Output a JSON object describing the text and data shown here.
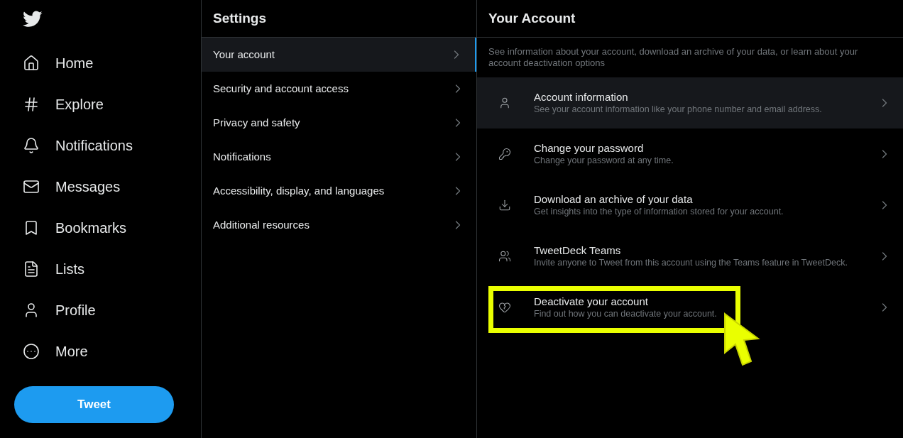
{
  "nav": {
    "items": [
      {
        "label": "Home"
      },
      {
        "label": "Explore"
      },
      {
        "label": "Notifications"
      },
      {
        "label": "Messages"
      },
      {
        "label": "Bookmarks"
      },
      {
        "label": "Lists"
      },
      {
        "label": "Profile"
      },
      {
        "label": "More"
      }
    ],
    "tweet_button": "Tweet"
  },
  "settings": {
    "title": "Settings",
    "items": [
      {
        "label": "Your account",
        "selected": true
      },
      {
        "label": "Security and account access",
        "selected": false
      },
      {
        "label": "Privacy and safety",
        "selected": false
      },
      {
        "label": "Notifications",
        "selected": false
      },
      {
        "label": "Accessibility, display, and languages",
        "selected": false
      },
      {
        "label": "Additional resources",
        "selected": false
      }
    ]
  },
  "account": {
    "title": "Your Account",
    "description": "See information about your account, download an archive of your data, or learn about your account deactivation options",
    "items": [
      {
        "title": "Account information",
        "subtitle": "See your account information like your phone number and email address.",
        "hovered": true,
        "highlighted": false
      },
      {
        "title": "Change your password",
        "subtitle": "Change your password at any time.",
        "hovered": false,
        "highlighted": false
      },
      {
        "title": "Download an archive of your data",
        "subtitle": "Get insights into the type of information stored for your account.",
        "hovered": false,
        "highlighted": false
      },
      {
        "title": "TweetDeck Teams",
        "subtitle": "Invite anyone to Tweet from this account using the Teams feature in TweetDeck.",
        "hovered": false,
        "highlighted": false
      },
      {
        "title": "Deactivate your account",
        "subtitle": "Find out how you can deactivate your account.",
        "hovered": false,
        "highlighted": true
      }
    ]
  }
}
